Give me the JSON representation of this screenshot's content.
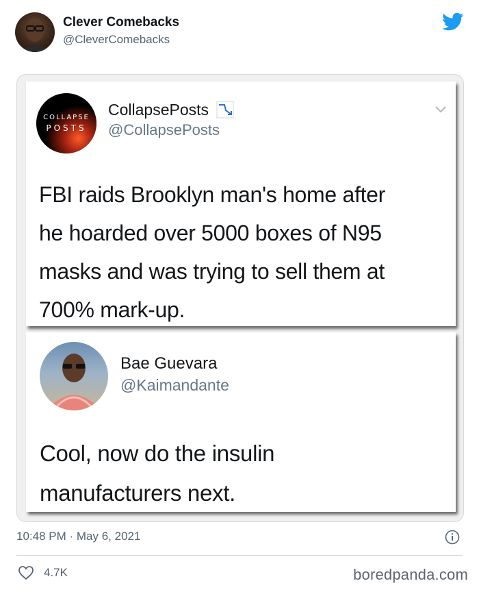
{
  "tweet": {
    "author_name": "Clever Comebacks",
    "author_handle": "@CleverComebacks",
    "timestamp": "10:48 PM · May 6, 2021",
    "likes": "4.7K"
  },
  "embedded": {
    "post1": {
      "logo_top": "COLLAPSE",
      "logo_bottom": "POSTS",
      "name": "CollapsePosts",
      "handle": "@CollapsePosts",
      "body_lines": [
        "FBI raids Brooklyn man's home after",
        "he hoarded over 5000 boxes of N95",
        "masks and was trying to sell them at",
        "700% mark-up."
      ]
    },
    "post2": {
      "name": "Bae Guevara",
      "handle": "@Kaimandante",
      "body_lines": [
        "Cool, now do the insulin",
        "manufacturers next."
      ]
    }
  },
  "watermark": "boredpanda.com",
  "icons": {
    "brand": "twitter-bird-icon",
    "info": "info-icon",
    "like": "heart-icon",
    "dropdown": "chevron-down-icon",
    "trend": "chart-decreasing-icon"
  },
  "colors": {
    "twitter_blue": "#1d9bf0",
    "secondary_text": "#536471"
  }
}
